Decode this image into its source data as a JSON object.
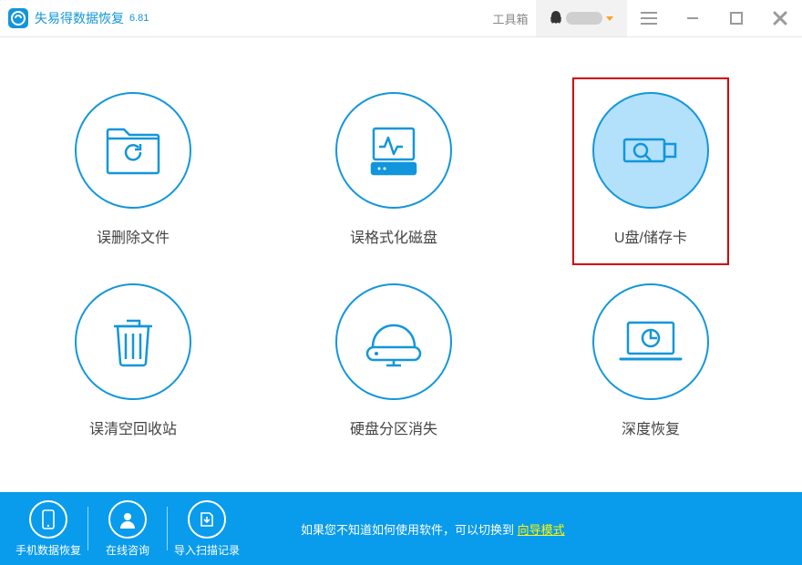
{
  "header": {
    "title": "失易得数据恢复",
    "version": "6.81",
    "toolbox": "工具箱"
  },
  "options": [
    {
      "label": "误删除文件"
    },
    {
      "label": "误格式化磁盘"
    },
    {
      "label": "U盘/储存卡"
    },
    {
      "label": "误清空回收站"
    },
    {
      "label": "硬盘分区消失"
    },
    {
      "label": "深度恢复"
    }
  ],
  "footer": {
    "btn_mobile": "手机数据恢复",
    "btn_consult": "在线咨询",
    "btn_import": "导入扫描记录",
    "hint_prefix": "如果您不知道如何使用软件，可以切换到 ",
    "hint_link": "向导模式"
  },
  "colors": {
    "accent": "#1296db",
    "footer": "#099bec",
    "highlight": "#d20000",
    "link": "#fff600"
  }
}
